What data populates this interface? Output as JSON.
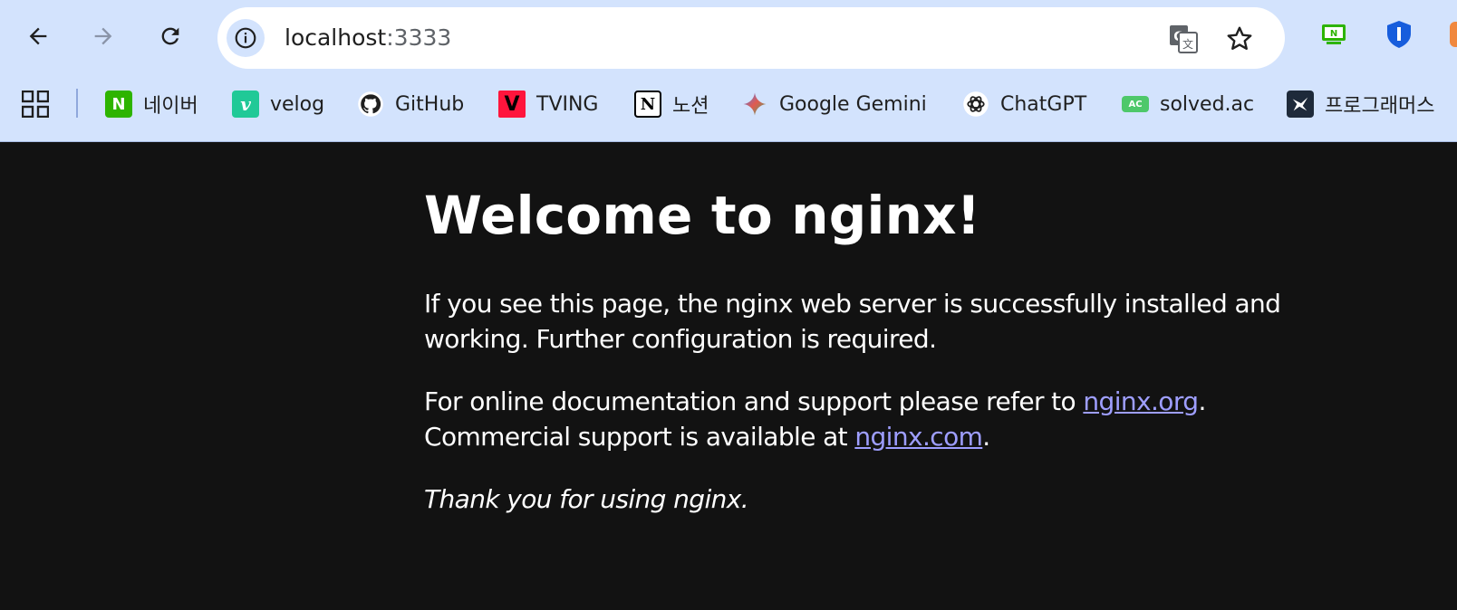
{
  "browser": {
    "url_host": "localhost",
    "url_port": ":3333",
    "icons": {
      "back": "back-arrow-icon",
      "forward": "forward-arrow-icon",
      "reload": "reload-icon",
      "site_info": "info-icon",
      "translate": "translate-icon",
      "bookmark": "star-icon"
    }
  },
  "bookmarks": [
    {
      "label": "네이버",
      "favicon_text": "N",
      "favicon_bg": "#2db400",
      "favicon_fg": "#ffffff"
    },
    {
      "label": "velog",
      "favicon_text": "v",
      "favicon_bg": "#20c997",
      "favicon_fg": "#ffffff"
    },
    {
      "label": "GitHub",
      "favicon_text": "",
      "favicon_bg": "transparent",
      "favicon_fg": "#ffffff"
    },
    {
      "label": "TVING",
      "favicon_text": "V",
      "favicon_bg": "#ff153c",
      "favicon_fg": "#000000"
    },
    {
      "label": "노션",
      "favicon_text": "N",
      "favicon_bg": "#ffffff",
      "favicon_fg": "#000000"
    },
    {
      "label": "Google Gemini",
      "favicon_text": "✦",
      "favicon_bg": "transparent",
      "favicon_fg": "#4a7cf0"
    },
    {
      "label": "ChatGPT",
      "favicon_text": "",
      "favicon_bg": "transparent",
      "favicon_fg": "#ffffff"
    },
    {
      "label": "solved.ac",
      "favicon_text": "AC",
      "favicon_bg": "#4ec86a",
      "favicon_fg": "#ffffff"
    },
    {
      "label": "프로그래머스",
      "favicon_text": "",
      "favicon_bg": "#1e2a3a",
      "favicon_fg": "#ffffff"
    }
  ],
  "page": {
    "heading": "Welcome to nginx!",
    "para1": "If you see this page, the nginx web server is successfully installed and working. Further configuration is required.",
    "para2_prefix": "For online documentation and support please refer to ",
    "link1": "nginx.org",
    "para2_mid": ".",
    "para2_line2": "Commercial support is available at ",
    "link2": "nginx.com",
    "para2_suffix": ".",
    "para3": "Thank you for using nginx."
  },
  "colors": {
    "chrome_bg": "#d3e3fd",
    "page_bg": "#121212",
    "link": "#9e9eff"
  }
}
